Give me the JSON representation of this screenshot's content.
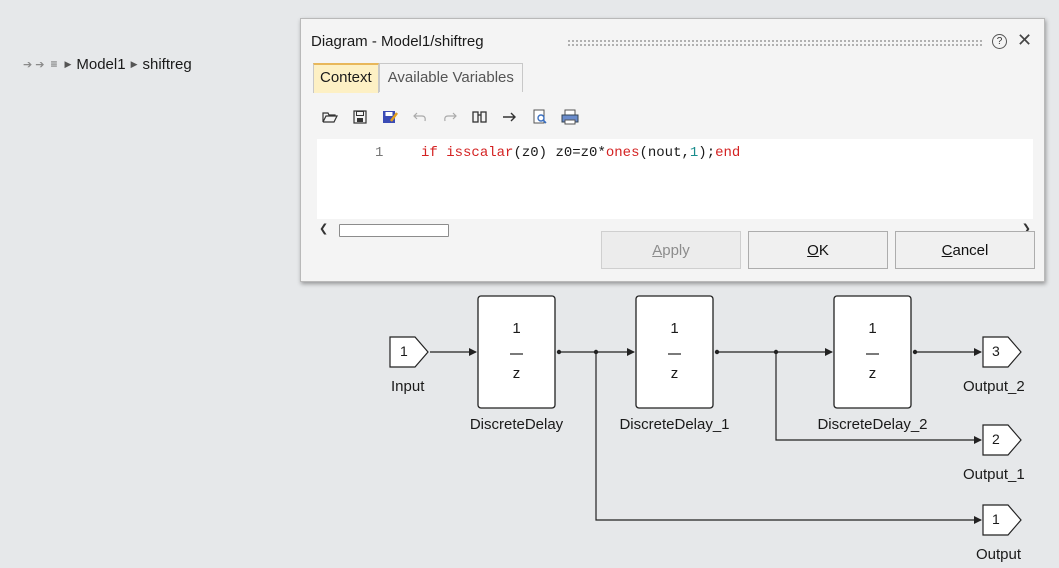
{
  "breadcrumb": {
    "items": [
      "Model1",
      "shiftreg"
    ]
  },
  "dialog": {
    "title": "Diagram - Model1/shiftreg",
    "help_icon": "question-circle-icon",
    "close_icon": "close-icon",
    "tabs": [
      {
        "label": "Context",
        "active": true
      },
      {
        "label": "Available Variables",
        "active": false
      }
    ],
    "toolbar": [
      "open-folder-icon",
      "save-icon",
      "save-as-icon",
      "undo-icon",
      "redo-icon",
      "find-icon",
      "goto-icon",
      "print-preview-icon",
      "print-icon"
    ],
    "editor": {
      "line_number": "1",
      "code": {
        "kw_if": "if",
        "fn_isscalar": "isscalar",
        "part1": "(z0) z0=z0*",
        "fn_ones": "ones",
        "part2": "(nout,",
        "num1": "1",
        "part3": ");",
        "kw_end": "end"
      }
    },
    "buttons": {
      "apply": {
        "pre": "",
        "mnemonic": "A",
        "post": "pply",
        "enabled": false
      },
      "ok": {
        "pre": "",
        "mnemonic": "O",
        "post": "K",
        "enabled": true
      },
      "cancel": {
        "pre": "",
        "mnemonic": "C",
        "post": "ancel",
        "enabled": true
      }
    }
  },
  "diagram": {
    "input": {
      "port": "1",
      "label": "Input"
    },
    "blocks": [
      {
        "numerator": "1",
        "denominator": "z",
        "label": "DiscreteDelay"
      },
      {
        "numerator": "1",
        "denominator": "z",
        "label": "DiscreteDelay_1"
      },
      {
        "numerator": "1",
        "denominator": "z",
        "label": "DiscreteDelay_2"
      }
    ],
    "outputs": [
      {
        "port": "3",
        "label": "Output_2"
      },
      {
        "port": "2",
        "label": "Output_1"
      },
      {
        "port": "1",
        "label": "Output"
      }
    ]
  },
  "colors": {
    "keyword": "#d42222",
    "number": "#1a8d8d",
    "active_tab": "#fdf0c4",
    "tab_accent": "#e8b75a"
  }
}
